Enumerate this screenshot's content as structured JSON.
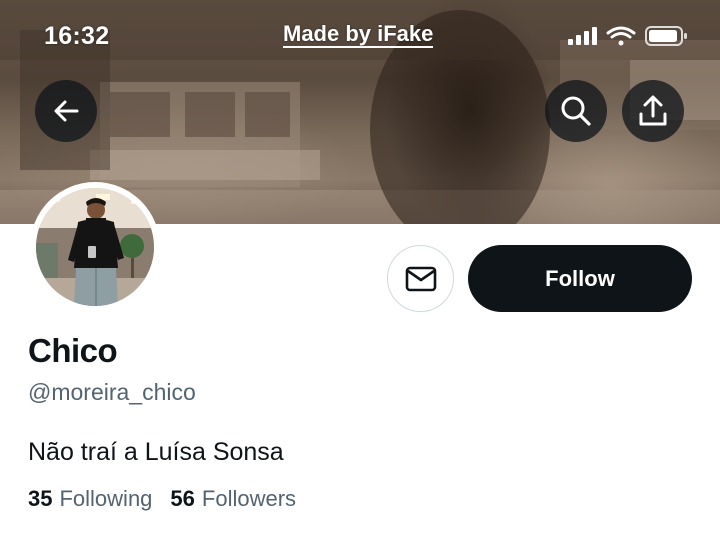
{
  "status_bar": {
    "time": "16:32",
    "watermark": "Made by iFake",
    "icons": [
      "cellular-signal-icon",
      "wifi-icon",
      "battery-icon"
    ]
  },
  "header": {
    "back_icon": "back-arrow-icon",
    "search_icon": "search-icon",
    "share_icon": "share-icon"
  },
  "profile": {
    "display_name": "Chico",
    "handle": "@moreira_chico",
    "bio": "Não traí a Luísa Sonsa",
    "following_count": "35",
    "following_label": "Following",
    "followers_count": "56",
    "followers_label": "Followers"
  },
  "actions": {
    "message_icon": "mail-icon",
    "follow_label": "Follow"
  },
  "colors": {
    "primary_text": "#0f1419",
    "secondary_text": "#536471",
    "follow_button": "#0f1419",
    "border": "#cfd9de"
  }
}
